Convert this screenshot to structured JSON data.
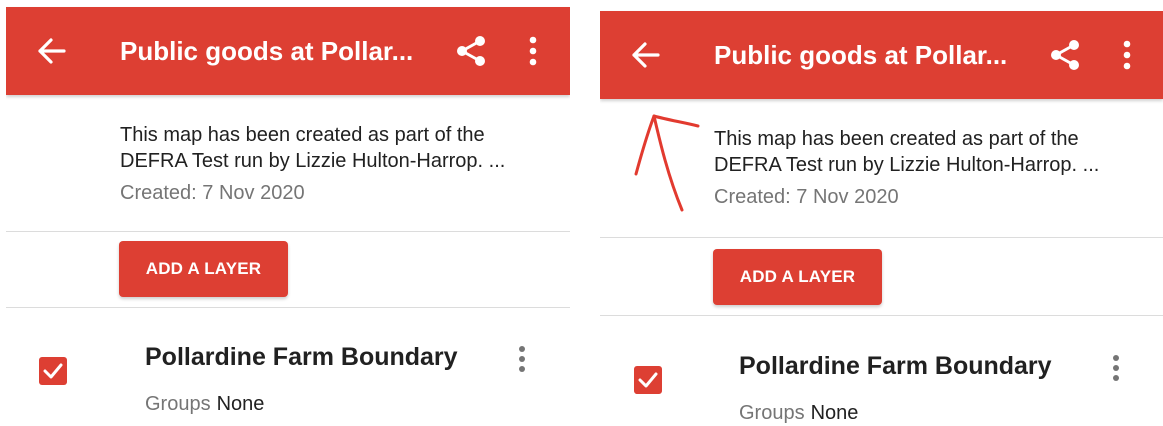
{
  "colors": {
    "accent": "#dd3f33",
    "secondary_text": "#757575"
  },
  "panels": [
    {
      "title": "Public goods at Pollar...",
      "description": "This map has been created as part of the",
      "description_line2": "DEFRA Test run by Lizzie Hulton-Harrop. ...",
      "created": "Created: 7 Nov 2020",
      "add_layer_label": "ADD A LAYER",
      "layer": {
        "name": "Pollardine Farm Boundary",
        "groups_label": "Groups",
        "groups_value": "None",
        "checked": true
      }
    },
    {
      "title": "Public goods at Pollar...",
      "description": "This map has been created as part of the",
      "description_line2": "DEFRA Test run by Lizzie Hulton-Harrop. ...",
      "created": "Created: 7 Nov 2020",
      "add_layer_label": "ADD A LAYER",
      "layer": {
        "name": "Pollardine Farm Boundary",
        "groups_label": "Groups",
        "groups_value": "None",
        "checked": true
      }
    }
  ],
  "icons": [
    "back-arrow-icon",
    "share-icon",
    "more-vert-icon",
    "checkbox-checked-icon"
  ]
}
